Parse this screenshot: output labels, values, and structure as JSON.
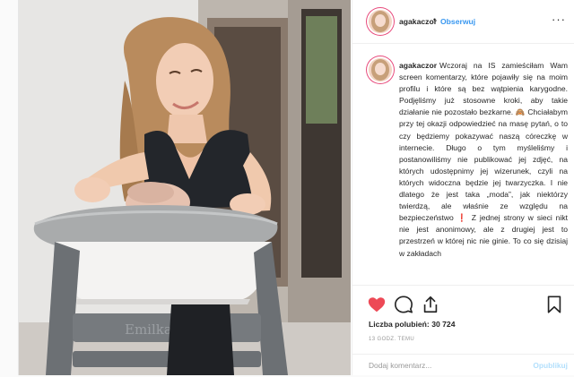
{
  "post": {
    "username": "agakaczor",
    "follow_separator": "•",
    "follow_label": "Obserwuj",
    "more_label": "···",
    "caption_text": "Wczoraj na IS zamieściłam Wam screen komentarzy, które pojawiły się na moim profilu i które są bez wątpienia karygodne. Podjęliśmy już stosowne kroki, aby takie działanie nie pozostało bezkarne. 🙈 Chciałabym przy tej okazji odpowiedzieć na masę pytań, o to czy będziemy pokazywać naszą córeczkę w internecie. Długo o tym myśleliśmy i postanowiliśmy nie publikować jej zdjęć, na których udostępnimy jej wizerunek, czyli na których widoczna będzie jej twarzyczka. I nie dlatego że jest taka „moda”, jak niektórzy twierdzą, ale właśnie ze względu na bezpieczeństwo ❗ Z jednej strony w sieci nikt nie jest anonimowy, ale z drugiej jest to przestrzeń w której nic nie ginie. To co się dzisiaj w zakładach",
    "likes_label": "Liczba polubień:",
    "likes_count": "30 724",
    "time_ago": "13 GODZ. TEMU",
    "comment_placeholder": "Dodaj komentarz...",
    "post_button_label": "Opublikuj",
    "chair_text": "Emilka"
  },
  "icons": {
    "like": "heart-icon-filled",
    "comment": "comment-icon",
    "share": "share-icon",
    "save": "bookmark-icon",
    "more": "more-options-icon"
  },
  "colors": {
    "like_red": "#ed4956",
    "link_blue": "#3897f0",
    "post_button_disabled": "#b2dffc",
    "story_ring": "#e84c7d"
  }
}
